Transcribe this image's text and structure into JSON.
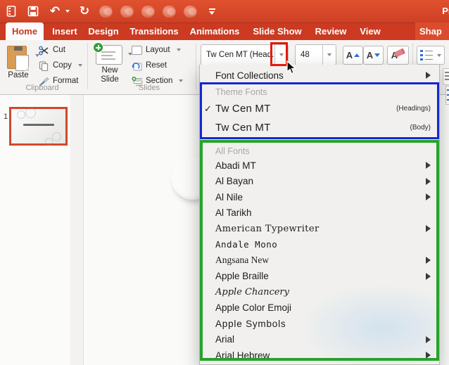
{
  "window": {
    "title_fragment": "Pr"
  },
  "tabs": [
    {
      "label": "Home",
      "active": true
    },
    {
      "label": "Insert"
    },
    {
      "label": "Design"
    },
    {
      "label": "Transitions"
    },
    {
      "label": "Animations"
    },
    {
      "label": "Slide Show"
    },
    {
      "label": "Review"
    },
    {
      "label": "View"
    },
    {
      "label": "Shap",
      "contextual": true
    }
  ],
  "ribbon": {
    "clipboard": {
      "group_label": "Clipboard",
      "paste": "Paste",
      "cut": "Cut",
      "copy": "Copy",
      "format": "Format"
    },
    "slides": {
      "group_label": "Slides",
      "new_slide": "New Slide",
      "layout": "Layout",
      "reset": "Reset",
      "section": "Section"
    },
    "font": {
      "font_name": "Tw Cen MT (Head...",
      "font_size": "48",
      "grow_letter": "A",
      "shrink_letter": "A",
      "clear_letter": "A"
    }
  },
  "thumbnail_panel": {
    "slide_number": "1"
  },
  "canvas": {
    "partial_letter": "P"
  },
  "menu": {
    "font_collections": "Font Collections",
    "theme_fonts": {
      "header": "Theme Fonts",
      "checkmark": "✓",
      "items": [
        {
          "label": "Tw Cen MT",
          "tag": "(Headings)",
          "checked": true
        },
        {
          "label": "Tw Cen MT",
          "tag": "(Body)"
        }
      ]
    },
    "all_fonts": {
      "header": "All Fonts",
      "items": [
        {
          "label": "Abadi MT",
          "submenu": true
        },
        {
          "label": "Al Bayan",
          "submenu": true
        },
        {
          "label": "Al Nile",
          "submenu": true
        },
        {
          "label": "Al Tarikh",
          "submenu": false
        },
        {
          "label": "American Typewriter",
          "submenu": true
        },
        {
          "label": "Andale Mono",
          "submenu": false
        },
        {
          "label": "Angsana New",
          "submenu": true
        },
        {
          "label": "Apple Braille",
          "submenu": true
        },
        {
          "label": "Apple Chancery",
          "submenu": false
        },
        {
          "label": "Apple Color Emoji",
          "submenu": false
        },
        {
          "label": "Apple Symbols",
          "submenu": false
        },
        {
          "label": "Arial",
          "submenu": true
        },
        {
          "label": "Arial Hebrew",
          "submenu": true
        }
      ]
    }
  },
  "colors": {
    "ribbon_red": "#CB3A21",
    "annotation_red": "#E4190C",
    "annotation_blue": "#1527CE",
    "annotation_green": "#26A32B",
    "selection_orange": "#D2482B"
  }
}
